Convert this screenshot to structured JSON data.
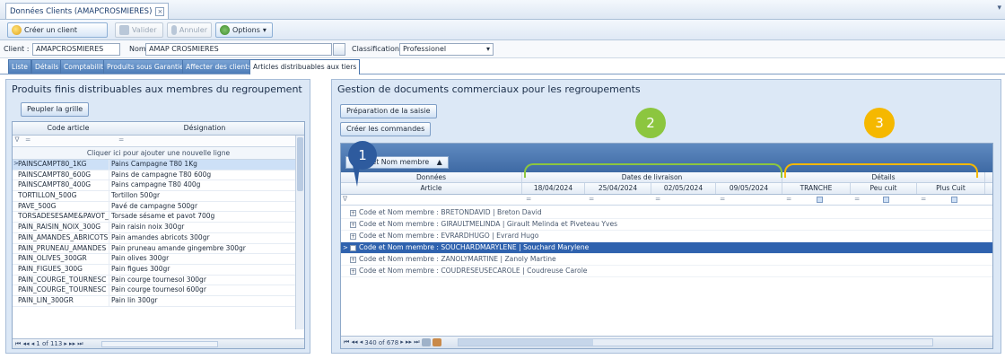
{
  "window": {
    "tab_title": "Données Clients (AMAPCROSMIERES)",
    "close_symbol": "×",
    "caret_symbol": "▾"
  },
  "toolbar": {
    "create_label": "Créer un client",
    "validate_label": "Valider",
    "cancel_label": "Annuler",
    "options_label": "Options",
    "options_caret": "▾"
  },
  "fields": {
    "client_label": "Client :",
    "client_value": "AMAPCROSMIERES",
    "name_label": "Nom :",
    "name_value": "AMAP CROSMIERES",
    "classification_label": "Classification :",
    "classification_value": "Professionel",
    "classification_caret": "▾"
  },
  "tabs": [
    "Liste",
    "Détails",
    "Comptabilité",
    "Produits sous Garantie",
    "Affecter des clients",
    "Articles distribuables aux tiers"
  ],
  "left_panel": {
    "title": "Produits finis distribuables aux membres du regroupement",
    "populate_button": "Peupler la grille",
    "col_code": "Code article",
    "col_designation": "Désignation",
    "filter_symbol": "=",
    "add_row_hint": "Cliquer ici pour ajouter une nouvelle ligne",
    "rows": [
      [
        "PAINSCAMPT80_1KG",
        "Pains Campagne T80 1Kg"
      ],
      [
        "PAINSCAMPT80_600G",
        "Pains de campagne T80 600g"
      ],
      [
        "PAINSCAMPT80_400G",
        "Pains campagne T80 400g"
      ],
      [
        "TORTILLON_500G",
        "Tortillon 500gr"
      ],
      [
        "PAVE_500G",
        "Pavé de campagne 500gr"
      ],
      [
        "TORSADESESAME&PAVOT_",
        "Torsade sésame et pavot 700g"
      ],
      [
        "PAIN_RAISIN_NOIX_300G",
        "Pain raisin noix 300gr"
      ],
      [
        "PAIN_AMANDES_ABRICOTS",
        "Pain amandes abricots 300gr"
      ],
      [
        "PAIN_PRUNEAU_AMANDES",
        "Pain pruneau amande gingembre 300gr"
      ],
      [
        "PAIN_OLIVES_300GR",
        "Pain olives 300gr"
      ],
      [
        "PAIN_FIGUES_300G",
        "Pain figues 300gr"
      ],
      [
        "PAIN_COURGE_TOURNESC",
        "Pain courge tournesol 300gr"
      ],
      [
        "PAIN_COURGE_TOURNESC",
        "Pain courge tournesol 600gr"
      ],
      [
        "PAIN_LIN_300GR",
        "Pain lin 300gr"
      ]
    ],
    "pager_text": "1 of 113"
  },
  "right_panel": {
    "title": "Gestion de documents commerciaux pour les regroupements",
    "prepare_button": "Préparation de la saisie",
    "create_orders_button": "Créer les commandes",
    "group_chip": "Code et Nom membre",
    "group_chip_arrow": "▲",
    "band_data": "Données",
    "band_dates": "Dates de livraison",
    "band_details": "Détails",
    "col_article": "Article",
    "dates": [
      "18/04/2024",
      "25/04/2024",
      "02/05/2024",
      "09/05/2024"
    ],
    "details_cols": [
      "TRANCHE",
      "Peu cuit",
      "Plus Cuit"
    ],
    "filter_symbol": "=",
    "groups": [
      "Code et Nom membre : BRETONDAVID | Breton David",
      "Code et Nom membre : GIRAULTMELINDA | Girault Melinda et Piveteau Yves",
      "Code et Nom membre : EVRARDHUGO | Evrard Hugo",
      "Code et Nom membre : SOUCHARDMARYLENE | Souchard Marylene",
      "Code et Nom membre : ZANOLYMARTINE | Zanoly Martine",
      "Code et Nom membre : COUDRESEUSECAROLE | Coudreuse Carole"
    ],
    "selected_group_index": 3,
    "pager_text": "340 of 678"
  },
  "callouts": [
    {
      "number": "1",
      "color": "#2e5b9e"
    },
    {
      "number": "2",
      "color": "#8cc63f"
    },
    {
      "number": "3",
      "color": "#f5b800"
    }
  ],
  "icons": {
    "row_indicator": ">",
    "filter_icon": "∇",
    "pager_nav_left": "⏮ ◂◂ ◂",
    "pager_nav_right": "▸ ▸▸ ⏭"
  }
}
